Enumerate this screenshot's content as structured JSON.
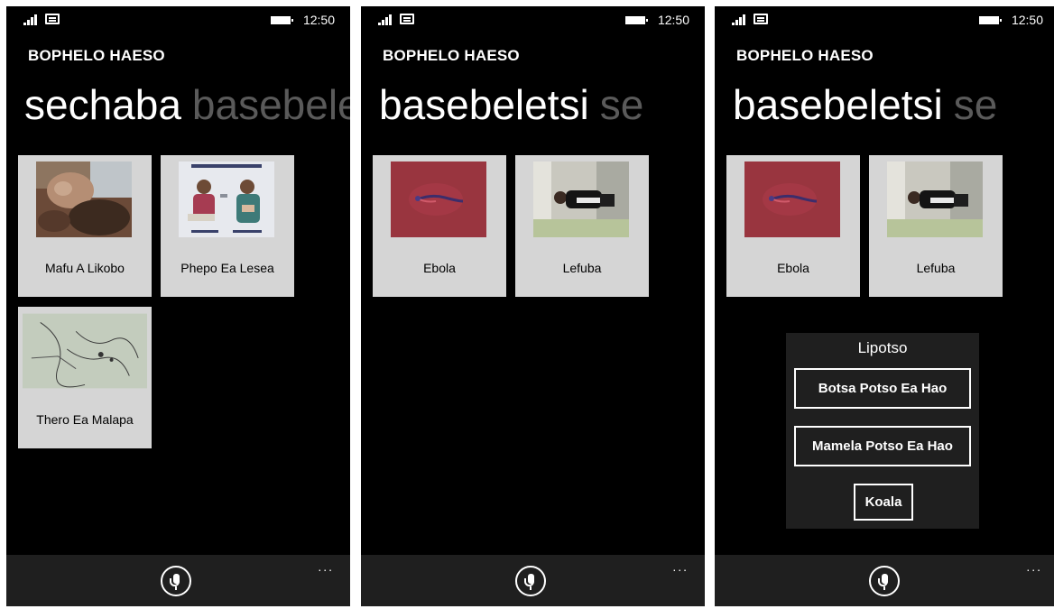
{
  "status": {
    "time": "12:50"
  },
  "app": {
    "title": "BOPHELO HAESO"
  },
  "screens": [
    {
      "pivot_active": "sechaba",
      "pivot_next": "basebeletsi",
      "tiles": [
        {
          "label": "Mafu A Likobo",
          "image": "injury-photo"
        },
        {
          "label": "Phepo Ea Lesea",
          "image": "breastfeeding-poster"
        },
        {
          "label": "Thero Ea Malapa",
          "image": "anatomy-sketch"
        }
      ]
    },
    {
      "pivot_active": "basebeletsi",
      "pivot_next": "se",
      "tiles": [
        {
          "label": "Ebola",
          "image": "ebola-virus-image"
        },
        {
          "label": "Lefuba",
          "image": "person-photo"
        }
      ]
    },
    {
      "pivot_active": "basebeletsi",
      "pivot_next": "se",
      "tiles": [
        {
          "label": "Ebola",
          "image": "ebola-virus-image"
        },
        {
          "label": "Lefuba",
          "image": "person-photo"
        }
      ],
      "popup": {
        "title": "Lipotso",
        "ask_button": "Botsa Potso Ea Hao",
        "listen_button": "Mamela Potso Ea Hao",
        "close_button": "Koala"
      }
    }
  ],
  "appbar": {
    "more": "...",
    "mic_icon": "microphone-icon"
  }
}
